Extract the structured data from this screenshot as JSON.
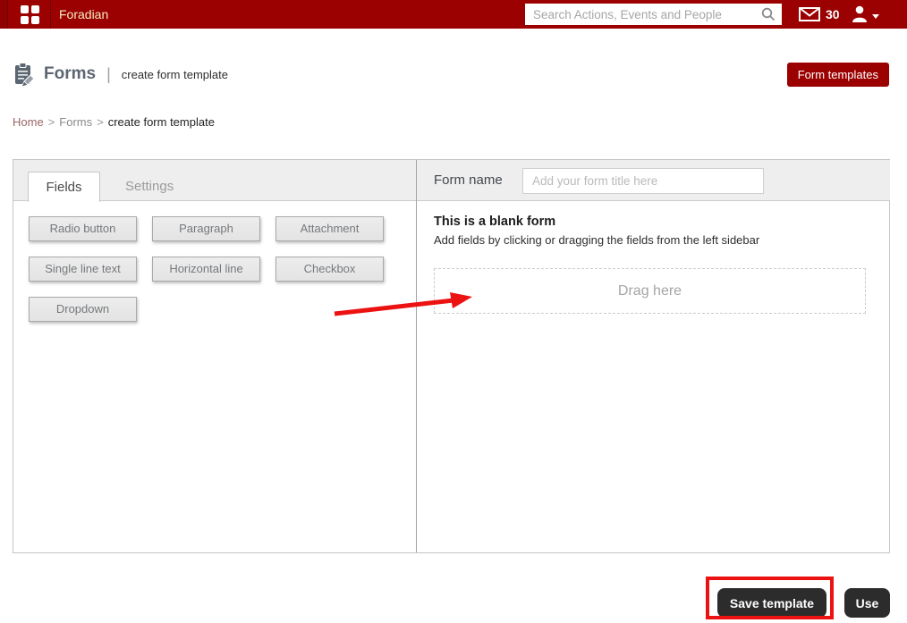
{
  "topbar": {
    "brand": "Foradian",
    "search_placeholder": "Search Actions, Events and People",
    "mail_count": "30"
  },
  "header": {
    "title": "Forms",
    "separator": "|",
    "subtitle": "create form template",
    "form_templates_button": "Form templates"
  },
  "breadcrumb": {
    "home": "Home",
    "forms": "Forms",
    "current": "create form template",
    "separator": ">"
  },
  "builder": {
    "tabs": [
      {
        "label": "Fields",
        "active": true
      },
      {
        "label": "Settings",
        "active": false
      }
    ],
    "field_buttons": [
      "Radio button",
      "Paragraph",
      "Attachment",
      "Single line text",
      "Horizontal line",
      "Checkbox",
      "Dropdown"
    ],
    "form_name_label": "Form name",
    "form_name_placeholder": "Add your form title here",
    "blank_form_title": "This is a blank form",
    "blank_form_subtitle": "Add fields by clicking or dragging the fields from the left sidebar",
    "drag_here_label": "Drag here"
  },
  "footer": {
    "save_button": "Save template",
    "use_button": "Use"
  },
  "colors": {
    "topbar_red": "#9b0101",
    "accent_red": "#9c0101",
    "annotation_red": "#ec1212",
    "dark_button": "#2c2c2c"
  }
}
